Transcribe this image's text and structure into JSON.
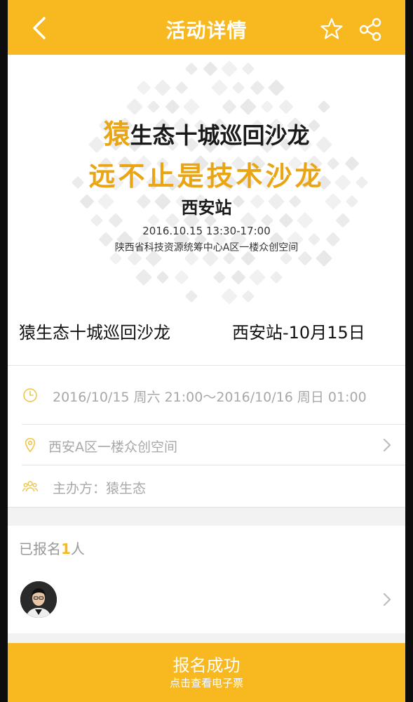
{
  "header": {
    "title": "活动详情",
    "back_icon": "chevron-left-icon",
    "favorite_icon": "star-icon",
    "share_icon": "share-icon"
  },
  "banner": {
    "line1_accent": "猿",
    "line1_rest": "生态十城巡回沙龙",
    "line2": "远不止是技术沙龙",
    "line3": "西安站",
    "line4": "2016.10.15  13:30-17:00",
    "line5": "陕西省科技资源统筹中心A区一楼众创空间"
  },
  "event": {
    "title_left": "猿生态十城巡回沙龙",
    "title_right": "西安站-10月15日"
  },
  "details": {
    "time": "2016/10/15 周六 21:00～2016/10/16 周日 01:00",
    "location": "西安A区一楼众创空间",
    "organizer": "主办方：猿生态"
  },
  "signup": {
    "prefix": "已报名",
    "count": "1",
    "suffix": "人"
  },
  "bottom_button": {
    "main": "报名成功",
    "sub": "点击查看电子票"
  },
  "colors": {
    "accent": "#f7b820",
    "banner_gold": "#e9a514",
    "muted_text": "#a8a8a8"
  }
}
